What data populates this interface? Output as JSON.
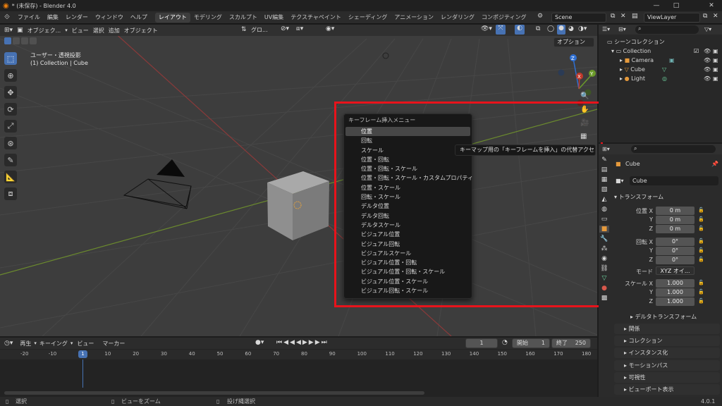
{
  "window": {
    "title": "* (未保存) - Blender 4.0"
  },
  "menu": {
    "file": "ファイル",
    "edit": "編集",
    "render": "レンダー",
    "window": "ウィンドウ",
    "help": "ヘルプ",
    "workspaces": [
      "レイアウト",
      "モデリング",
      "スカルプト",
      "UV編集",
      "テクスチャペイント",
      "シェーディング",
      "アニメーション",
      "レンダリング",
      "コンポジティング"
    ],
    "scene": "Scene",
    "view_layer": "ViewLayer"
  },
  "viewport": {
    "mode": "オブジェク...",
    "view": "ビュー",
    "select": "選択",
    "add": "追加",
    "object": "オブジェクト",
    "transform_orientation": "グロ...",
    "options": "オプション",
    "info_line1": "ユーザー・透視投影",
    "info_line2": "(1) Collection | Cube",
    "gizmo": {
      "x": "X",
      "y": "Y",
      "z": "Z"
    }
  },
  "keyframe_menu": {
    "title": "キーフレーム挿入メニュー",
    "items": [
      "位置",
      "回転",
      "スケール",
      "位置・回転",
      "位置・回転・スケール",
      "位置・回転・スケール・カスタムプロパティ",
      "位置・スケール",
      "回転・スケール",
      "デルタ位置",
      "デルタ回転",
      "デルタスケール",
      "ビジュアル位置",
      "ビジュアル回転",
      "ビジュアルスケール",
      "ビジュアル位置・回転",
      "ビジュアル位置・回転・スケール",
      "ビジュアル位置・スケール",
      "ビジュアル回転・スケール"
    ]
  },
  "tooltip": "キーマップ用の「キーフレームを挿入」の代替アクセス.",
  "outliner": {
    "scene_collection": "シーンコレクション",
    "items": [
      "Collection",
      "Camera",
      "Cube",
      "Light"
    ]
  },
  "properties": {
    "object_name": "Cube",
    "object_field": "Cube",
    "transform": "トランスフォーム",
    "location_label": "位置 X",
    "rotation_label": "回転 X",
    "mode_label": "モード",
    "scale_label": "スケール X",
    "y_label": "Y",
    "z_label": "Z",
    "location": [
      "0 m",
      "0 m",
      "0 m"
    ],
    "rotation": [
      "0°",
      "0°",
      "0°"
    ],
    "mode": "XYZ オイ...",
    "scale": [
      "1.000",
      "1.000",
      "1.000"
    ],
    "sections": [
      "デルタトランスフォーム",
      "関係",
      "コレクション",
      "インスタンス化",
      "モーションパス",
      "可視性",
      "ビューポート表示"
    ]
  },
  "timeline": {
    "playback": "再生",
    "keying": "キーイング",
    "view": "ビュー",
    "marker": "マーカー",
    "current_frame": "1",
    "start_label": "開始",
    "start": "1",
    "end_label": "終了",
    "end": "250",
    "ticks": [
      "-20",
      "-10",
      "1",
      "10",
      "20",
      "30",
      "40",
      "50",
      "60",
      "70",
      "80",
      "90",
      "100",
      "110",
      "120",
      "130",
      "140",
      "150",
      "160",
      "170",
      "180"
    ]
  },
  "status": {
    "select": "選択",
    "zoom": "ビューをズーム",
    "lasso": "投げ縄選択",
    "version": "4.0.1"
  }
}
